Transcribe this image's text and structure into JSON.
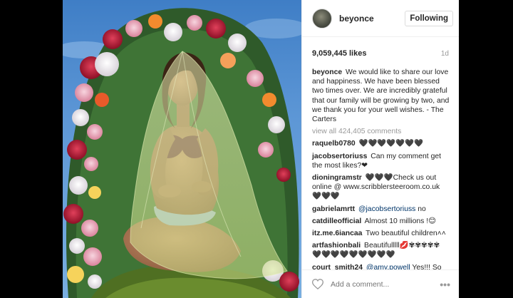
{
  "post": {
    "username": "beyonce",
    "follow_label": "Following",
    "likes": "9,059,445 likes",
    "age": "1d",
    "caption": {
      "user": "beyonce",
      "text": "We would like to share our love and happiness. We have been blessed two times over. We are incredibly grateful that our family will be growing by two, and we thank you for your well wishes. - The Carters"
    },
    "view_all": "view all 424,405 comments",
    "comments": [
      {
        "user": "raquelb0780",
        "text": "🖤🖤🖤🖤🖤🖤🖤"
      },
      {
        "user": "jacobsertoriuss",
        "text": "Can my comment get the most likes?❤"
      },
      {
        "user": "dioningramstr",
        "text": "🖤🖤🖤Check us out online @ www.scribblersteeroom.co.uk 🖤🖤🖤"
      },
      {
        "user": "gabrielamrtt",
        "mention": "@jacobsertoriuss",
        "text": " no"
      },
      {
        "user": "catdilleofficial",
        "text": "Almost 10 millions !😊"
      },
      {
        "user": "itz.me.6iancaa",
        "text": "Two beautiful children˄˄"
      },
      {
        "user": "artfashionbali",
        "text": "Beautifulllll💋✾✾✾✾✾ 🖤🖤🖤🖤🖤🖤🖤🖤🖤"
      },
      {
        "user": "court_smith24",
        "mention": "@amy.powell",
        "text": " Yes!!! So"
      }
    ],
    "add_comment_placeholder": "Add a comment...",
    "more_label": "•••"
  },
  "colors": {
    "sky": "#5d97d6",
    "veil": "#d8e79a",
    "text": "#262626",
    "muted": "#999999",
    "mention": "#003569"
  },
  "icons": {
    "like": "heart-icon",
    "options": "more-options-icon"
  }
}
